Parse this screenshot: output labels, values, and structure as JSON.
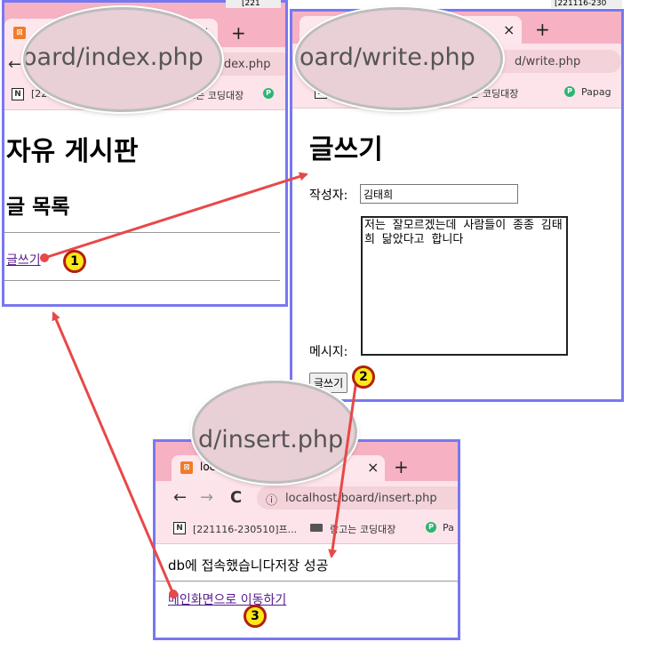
{
  "panel_index": {
    "url_zoom": "oard/index.php",
    "url": "index.php",
    "tab_close": "×",
    "new_tab": "+",
    "back": "←",
    "bookmark_1": "[221",
    "bookmark_2": "고는 코딩대장",
    "top_strip": "[221",
    "title": "자유 게시판",
    "subtitle": "글 목록",
    "write_link": "글쓰기"
  },
  "panel_write": {
    "url_zoom": "oard/write.php",
    "url": "d/write.php",
    "tab_close": "×",
    "new_tab": "+",
    "top_strip": "[221116-230",
    "bookmark_1": "[2",
    "bookmark_2": "랑고는 코딩대장",
    "bookmark_3": "Papag",
    "title": "글쓰기",
    "author_label": "작성자:",
    "author_value": "김태희",
    "message_label": "메시지:",
    "message_value": "저는 잘모르겠는데 사람들이 종종 김태희 닮았다고 합니다",
    "submit_button": "글쓰기"
  },
  "panel_insert": {
    "url_zoom": "d/insert.php",
    "tab_title": "loca",
    "tab_close": "×",
    "new_tab": "+",
    "back": "←",
    "forward": "→",
    "reload": "C",
    "info": "ⓘ",
    "url": "localhost/board/insert.php",
    "bookmark_1": "[221116-230510]프...",
    "bookmark_2": "랑고는 코딩대장",
    "bookmark_3": "Pa",
    "message": "db에 접속했습니다저장 성공",
    "main_link": "메인화면으로 이동하기"
  },
  "badges": {
    "one": "1",
    "two": "2",
    "three": "3"
  },
  "colors": {
    "panel_border": "#7878f0",
    "tabbar": "#f6b2c2",
    "arrow": "#e84848",
    "badge_fill": "#ffe818"
  }
}
